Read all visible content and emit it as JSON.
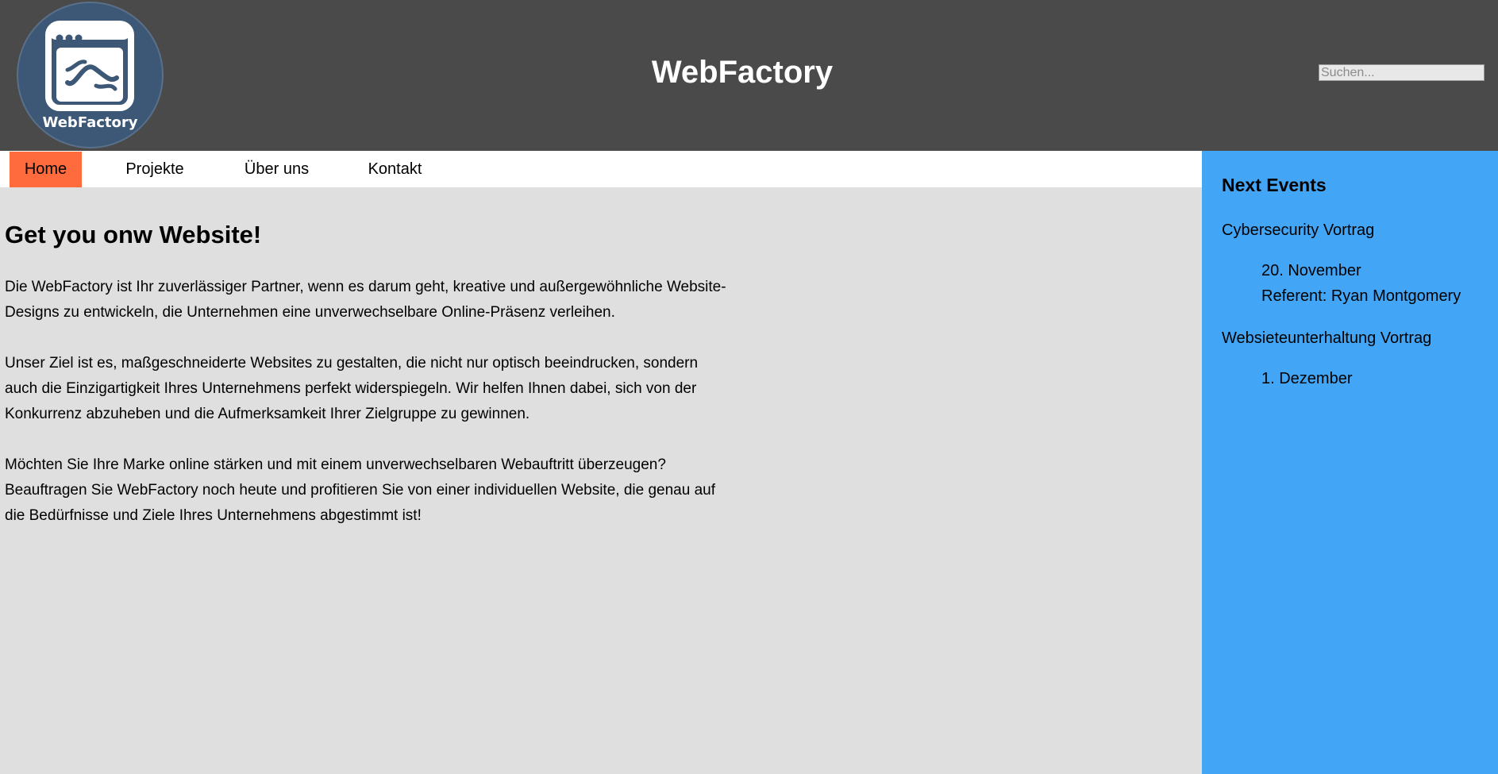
{
  "header": {
    "title": "WebFactory",
    "logo_text": "WebFactory",
    "search": {
      "placeholder": "Suchen...",
      "value": ""
    }
  },
  "nav": {
    "items": [
      {
        "label": "Home",
        "active": true
      },
      {
        "label": "Projekte"
      },
      {
        "label": "Über uns"
      },
      {
        "label": "Kontakt"
      }
    ]
  },
  "main": {
    "heading": "Get you onw Website!",
    "paragraphs": [
      "Die WebFactory ist Ihr zuverlässiger Partner, wenn es darum geht, kreative und außergewöhnliche Website-Designs zu entwickeln, die Unternehmen eine unverwechselbare Online-Präsenz verleihen.",
      "Unser Ziel ist es, maßgeschneiderte Websites zu gestalten, die nicht nur optisch beeindrucken, sondern auch die Einzigartigkeit Ihres Unternehmens perfekt widerspiegeln. Wir helfen Ihnen dabei, sich von der Konkurrenz abzuheben und die Aufmerksamkeit Ihrer Zielgruppe zu gewinnen.",
      "Möchten Sie Ihre Marke online stärken und mit einem unverwechselbaren Webauftritt überzeugen? Beauftragen Sie WebFactory noch heute und profitieren Sie von einer individuellen Website, die genau auf die Bedürfnisse und Ziele Ihres Unternehmens abgestimmt ist!"
    ]
  },
  "sidebar": {
    "title": "Next Events",
    "events": [
      {
        "name": "Cybersecurity Vortrag",
        "details": [
          "20. November",
          "Referent: Ryan Montgomery"
        ]
      },
      {
        "name": "Websieteunterhaltung Vortrag",
        "details": [
          "1. Dezember"
        ]
      }
    ]
  },
  "colors": {
    "header_bg": "#4a4a4a",
    "nav_active": "#ff6b3d",
    "sidebar_bg": "#42a5f5",
    "content_bg": "#dfdfdf",
    "logo_bg": "#3c5876"
  },
  "icons": {
    "logo": "browser-window-icon"
  }
}
